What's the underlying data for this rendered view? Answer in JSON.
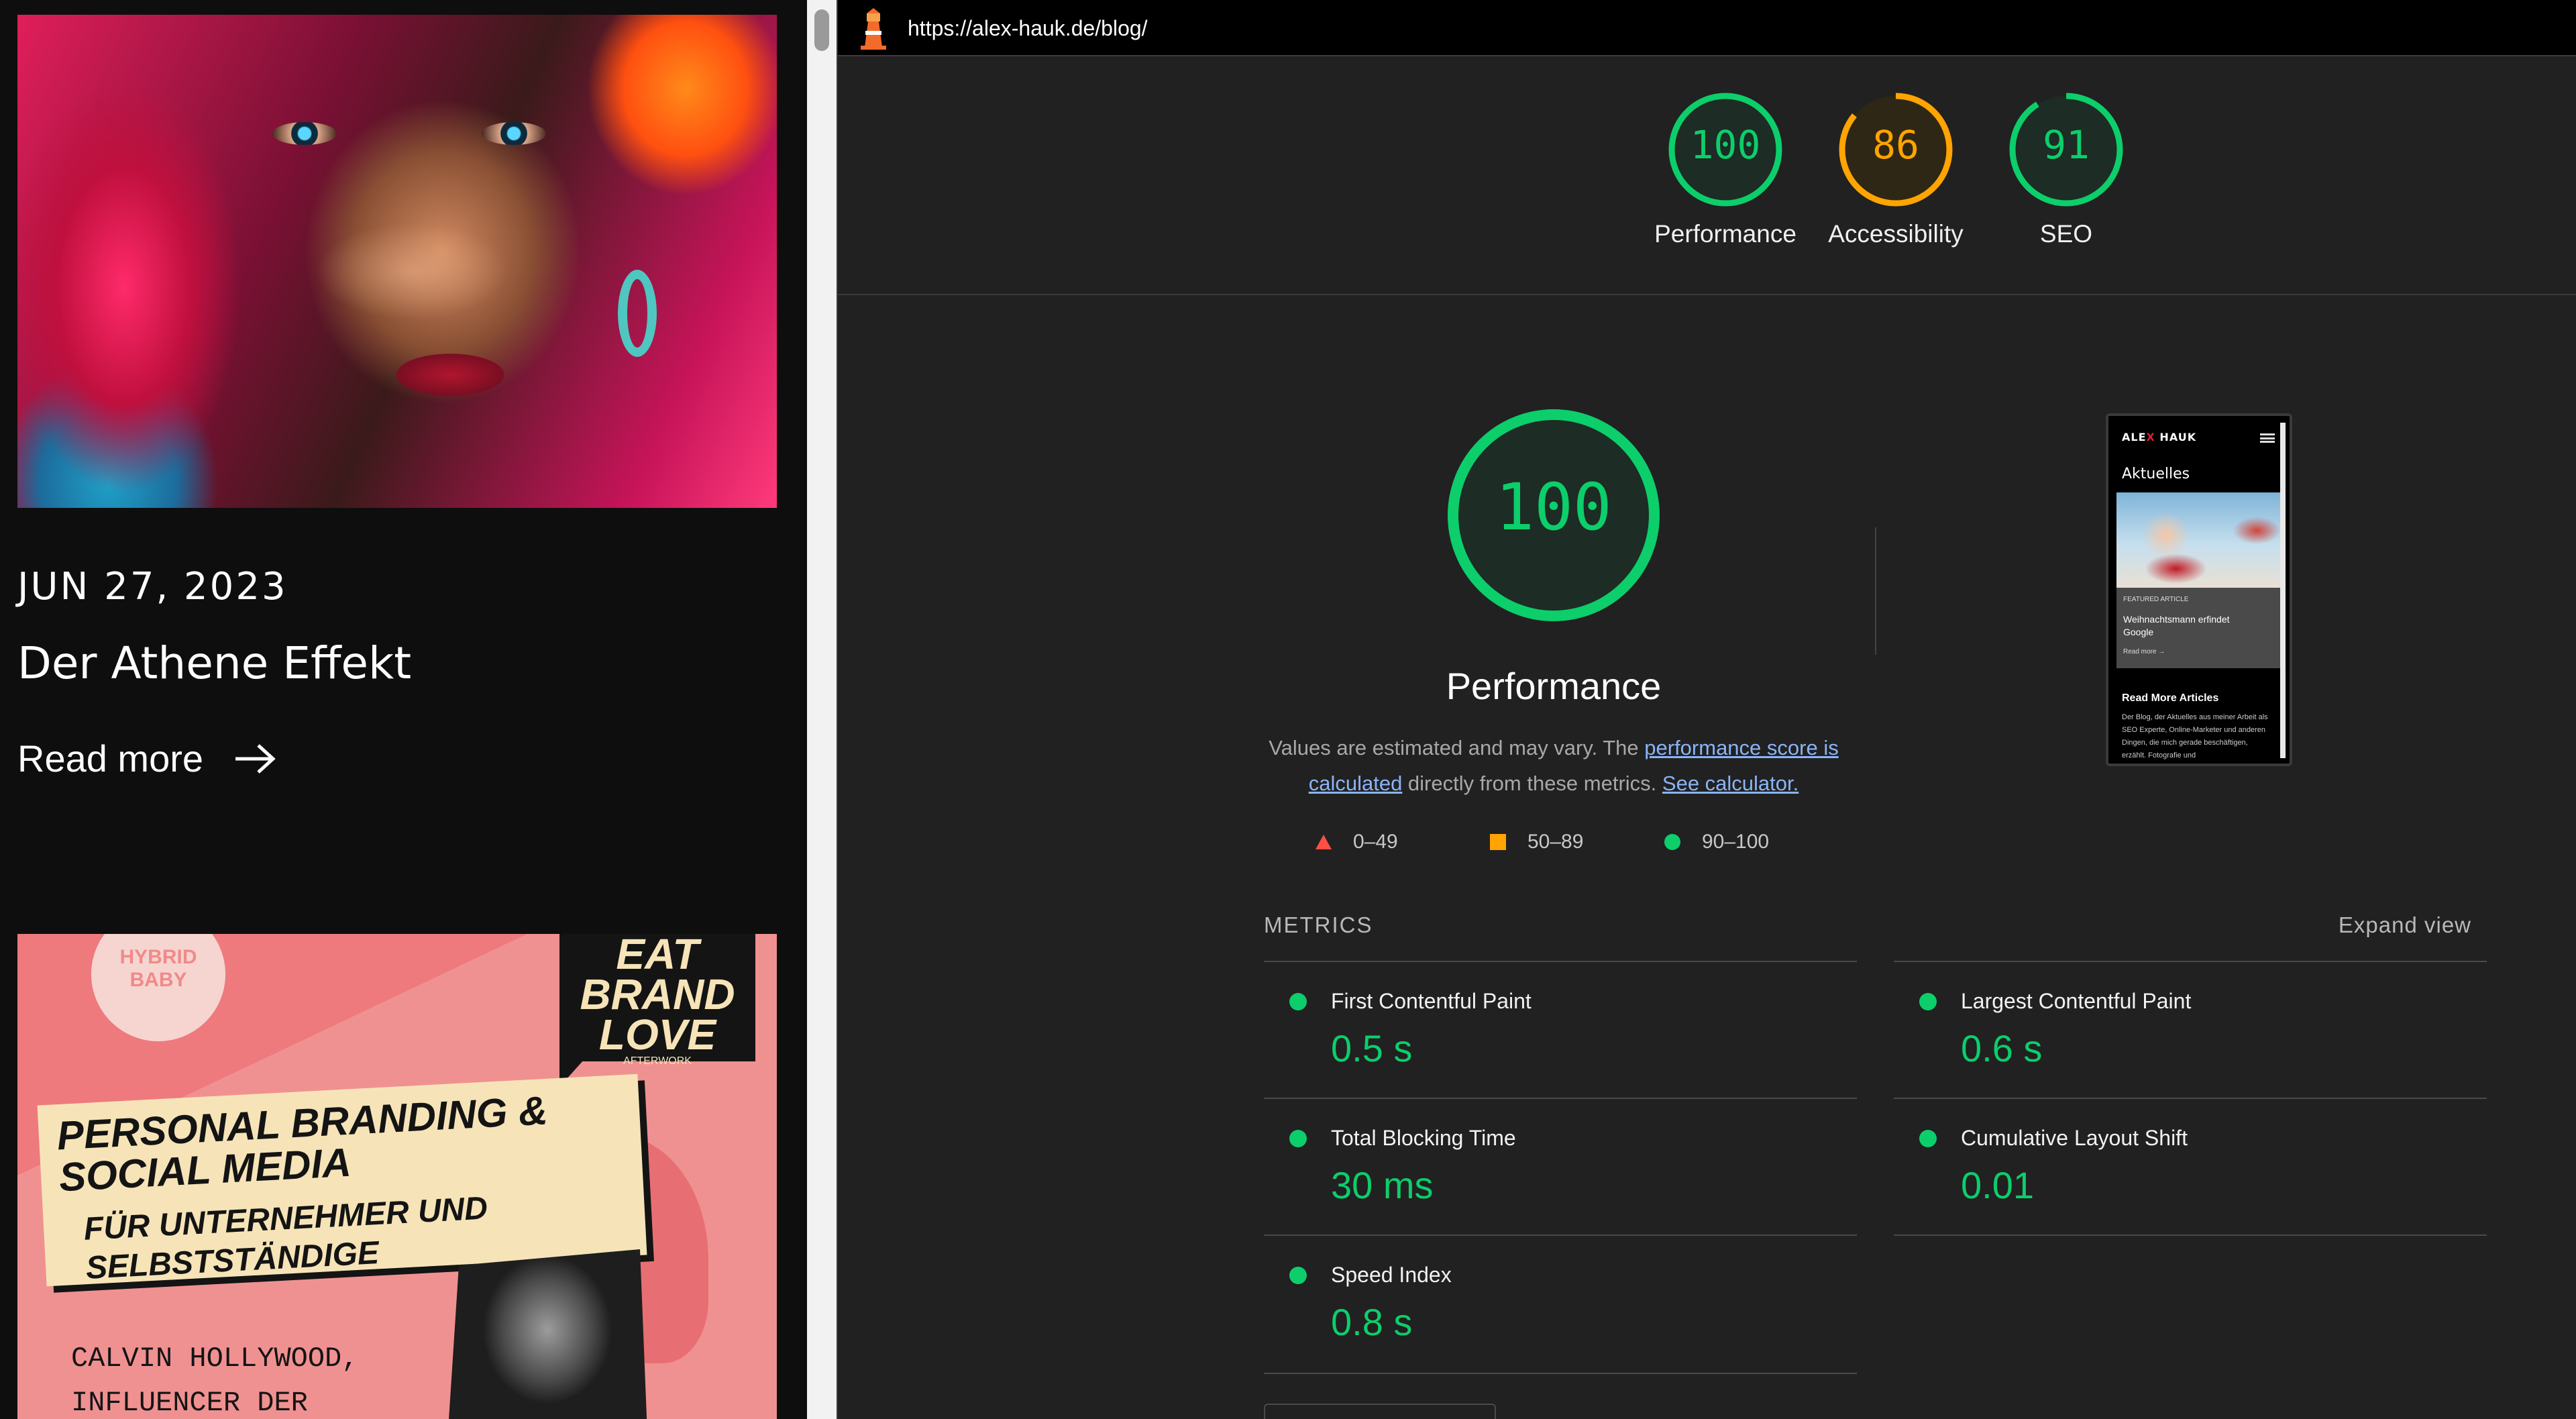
{
  "blog": {
    "post_date": "JUN 27, 2023",
    "post_title": "Der Athene Effekt",
    "read_more": "Read more",
    "promo": {
      "badge": "HYBRID BABY",
      "eat_line1": "EAT",
      "eat_line2": "BRAND",
      "eat_line3": "LOVE",
      "eat_sub": "AFTERWORK",
      "title": "PERSONAL BRANDING & SOCIAL MEDIA",
      "subtitle": "FÜR UNTERNEHMER UND SELBSTSTÄNDIGE",
      "speaker_line1": "CALVIN HOLLYWOOD,",
      "speaker_line2": "INFLUENCER DER"
    }
  },
  "report": {
    "url": "https://alex-hauk.de/blog/",
    "gauges": [
      {
        "label": "Performance",
        "score": "100",
        "value": 100,
        "color": "#0cce6b",
        "bg": "#1d2c24"
      },
      {
        "label": "Accessibility",
        "score": "86",
        "value": 86,
        "color": "#ffa400",
        "bg": "#2e2716"
      },
      {
        "label": "SEO",
        "score": "91",
        "value": 91,
        "color": "#0cce6b",
        "bg": "#1d2c24"
      }
    ],
    "big_score": "100",
    "big_score_value": 100,
    "perf_title": "Performance",
    "desc_text1": "Values are estimated and may vary. The ",
    "desc_link1": "performance score is calculated",
    "desc_text2": " directly from these metrics. ",
    "desc_link2": "See calculator.",
    "legend": [
      {
        "range": "0–49",
        "shape": "triangle",
        "color": "#ff4e42"
      },
      {
        "range": "50–89",
        "shape": "square",
        "color": "#ffa400"
      },
      {
        "range": "90–100",
        "shape": "circle",
        "color": "#0cce6b"
      }
    ],
    "thumbnail": {
      "logo_a": "ALE",
      "logo_x": "X",
      "logo_b": " HAUK",
      "heading": "Aktuelles",
      "featured": "FEATURED ARTICLE",
      "card_title": "Weihnachtsmann erfindet Google",
      "read_more": "Read more →",
      "more_title": "Read More Articles",
      "body": "Der Blog, der Aktuelles aus meiner Arbeit als SEO Experte, Online-Marketer und anderen Dingen, die mich gerade beschäftigen, erzählt. Fotografie und"
    },
    "metrics_title": "METRICS",
    "expand_view": "Expand view",
    "metrics": [
      {
        "label": "First Contentful Paint",
        "value": "0.5 s"
      },
      {
        "label": "Largest Contentful Paint",
        "value": "0.6 s"
      },
      {
        "label": "Total Blocking Time",
        "value": "30 ms"
      },
      {
        "label": "Cumulative Layout Shift",
        "value": "0.01"
      },
      {
        "label": "Speed Index",
        "value": "0.8 s"
      }
    ],
    "colors": {
      "pass": "#0cce6b",
      "average": "#ffa400",
      "fail": "#ff4e42",
      "link": "#8ab4f8"
    }
  }
}
